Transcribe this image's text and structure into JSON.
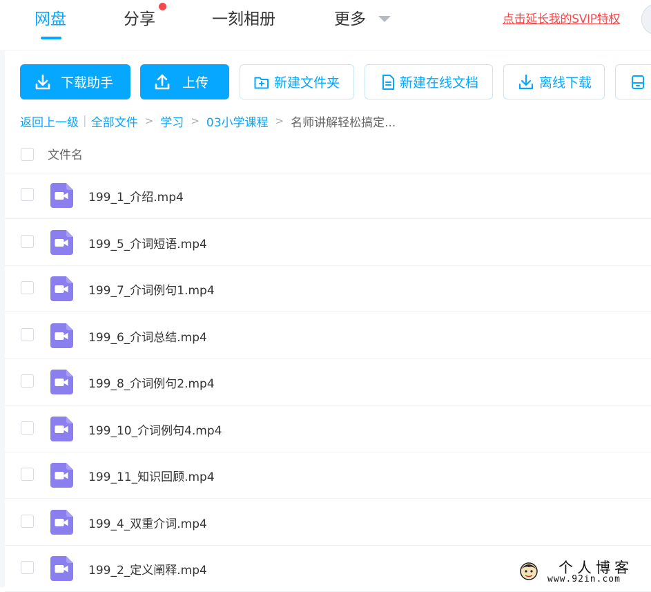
{
  "nav": {
    "tabs": [
      {
        "label": "网盘",
        "active": true
      },
      {
        "label": "分享",
        "badge": "red-dot"
      },
      {
        "label": "一刻相册"
      },
      {
        "label": "更多",
        "has_dropdown": true
      }
    ],
    "svip_link": "点击延长我的SVIP特权",
    "accent_color": "#06a7ff",
    "badge_color": "#f5484a"
  },
  "toolbar": {
    "download_helper": "下载助手",
    "upload": "上传",
    "new_folder": "新建文件夹",
    "new_online_doc": "新建在线文档",
    "offline_download": "离线下载"
  },
  "breadcrumb": {
    "back": "返回上一级",
    "all_files": "全部文件",
    "level1": "学习",
    "level2": "03小学课程",
    "current": "名师讲解轻松搞定..."
  },
  "list": {
    "header": "文件名",
    "files": [
      {
        "name": "199_1_介绍.mp4",
        "icon": "video-file-icon"
      },
      {
        "name": "199_5_介词短语.mp4",
        "icon": "video-file-icon"
      },
      {
        "name": "199_7_介词例句1.mp4",
        "icon": "video-file-icon"
      },
      {
        "name": "199_6_介词总结.mp4",
        "icon": "video-file-icon"
      },
      {
        "name": "199_8_介词例句2.mp4",
        "icon": "video-file-icon"
      },
      {
        "name": "199_10_介词例句4.mp4",
        "icon": "video-file-icon"
      },
      {
        "name": "199_11_知识回顾.mp4",
        "icon": "video-file-icon"
      },
      {
        "name": "199_4_双重介词.mp4",
        "icon": "video-file-icon"
      },
      {
        "name": "199_2_定义阐释.mp4",
        "icon": "video-file-icon"
      }
    ],
    "video_icon_color": "#8b7ff0"
  },
  "watermark": {
    "line1": "个人博客",
    "line2": "www.92in.com"
  }
}
